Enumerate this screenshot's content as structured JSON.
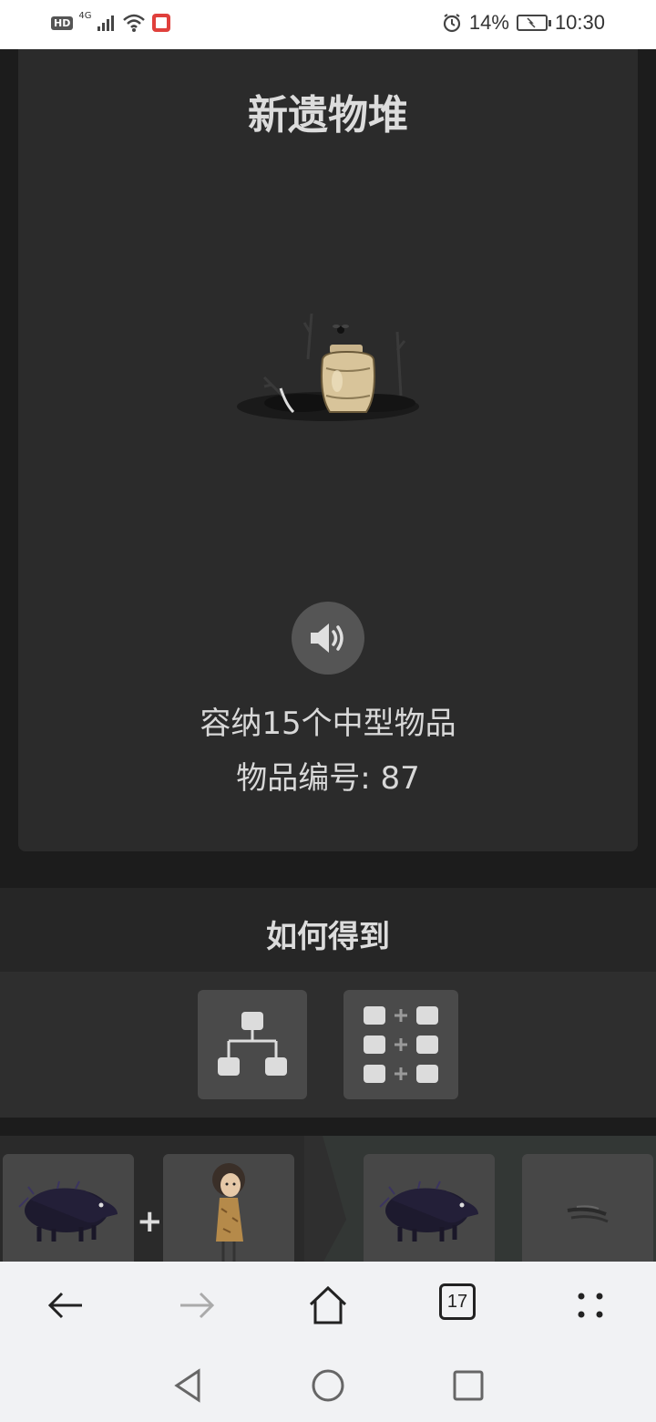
{
  "status_bar": {
    "hd": "HD",
    "network": "4G",
    "battery_percent": "14%",
    "time": "10:30",
    "icons": [
      "signal-icon",
      "wifi-icon",
      "notification-app-icon",
      "alarm-icon",
      "battery-charging-icon"
    ]
  },
  "item": {
    "title": "新遗物堆",
    "capacity_text": "容纳15个中型物品",
    "id_text": "物品编号: 87"
  },
  "how_to_get": {
    "title": "如何得到",
    "buttons": [
      "tree-view-icon",
      "recipe-grid-icon"
    ]
  },
  "recipe": {
    "plus": "+",
    "inputs": [
      "boar-icon",
      "child-character-icon"
    ],
    "outputs": [
      "boar-icon",
      "feather-icon"
    ]
  },
  "browser_bar": {
    "tab_count": "17",
    "icons": [
      "back-arrow-icon",
      "forward-arrow-icon",
      "home-icon",
      "tabs-icon",
      "menu-icon"
    ]
  },
  "colors": {
    "card": "#2b2b2b",
    "page": "#1a1a1a",
    "text": "#dcdcdc",
    "button": "#4a4a4a"
  }
}
